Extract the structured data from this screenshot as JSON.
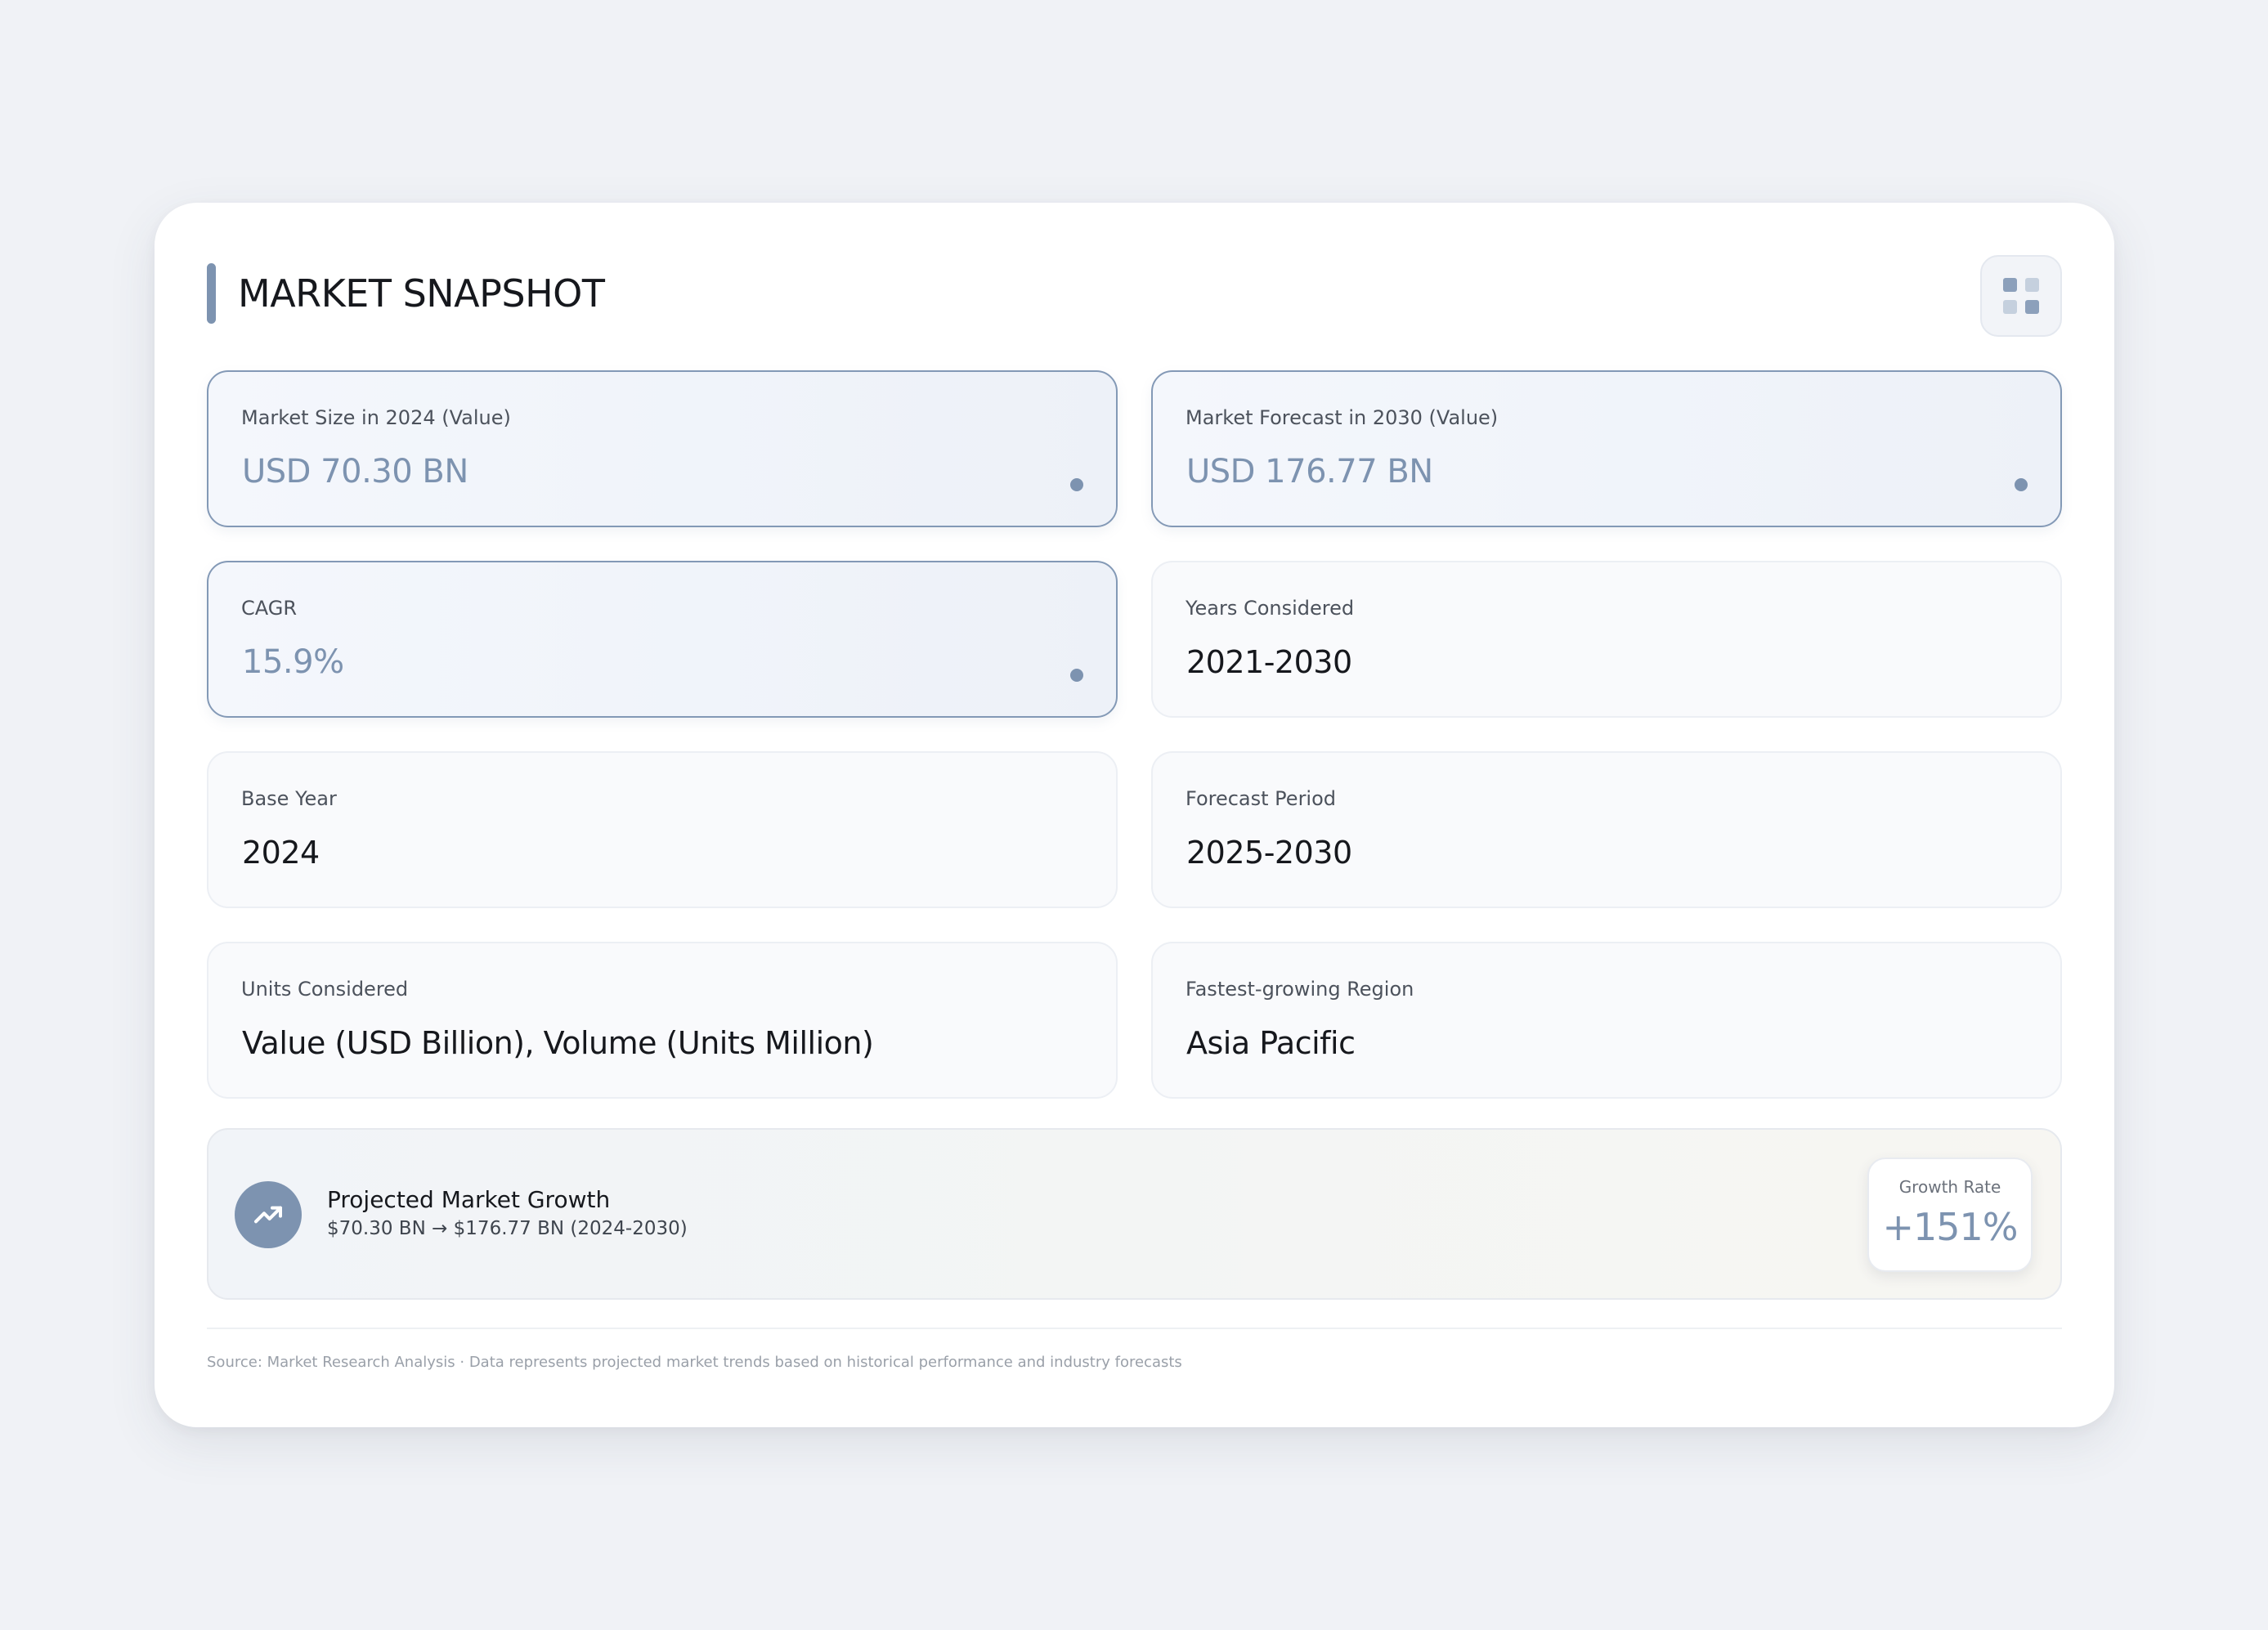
{
  "header": {
    "title": "MARKET SNAPSHOT",
    "layout_icon": "grid-icon"
  },
  "metrics": [
    {
      "label": "Market Size in 2024 (Value)",
      "value": "USD 70.30 BN",
      "highlighted": true
    },
    {
      "label": "Market Forecast in 2030 (Value)",
      "value": "USD 176.77 BN",
      "highlighted": true
    },
    {
      "label": "CAGR",
      "value": "15.9%",
      "highlighted": true
    },
    {
      "label": "Years Considered",
      "value": "2021-2030",
      "highlighted": false
    },
    {
      "label": "Base Year",
      "value": "2024",
      "highlighted": false
    },
    {
      "label": "Forecast Period",
      "value": "2025-2030",
      "highlighted": false
    },
    {
      "label": "Units Considered",
      "value": "Value (USD Billion), Volume (Units Million)",
      "highlighted": false
    },
    {
      "label": "Fastest-growing Region",
      "value": "Asia Pacific",
      "highlighted": false
    }
  ],
  "growth": {
    "icon": "trending-up-icon",
    "title": "Projected Market Growth",
    "subtitle": "$70.30 BN → $176.77 BN (2024-2030)",
    "rate_label": "Growth Rate",
    "rate_value": "+151%"
  },
  "footer": {
    "source": "Source: Market Research Analysis · Data represents projected market trends based on historical performance and industry forecasts"
  },
  "colors": {
    "accent": "#7d93b0",
    "background": "#f0f2f6",
    "card": "#ffffff"
  }
}
